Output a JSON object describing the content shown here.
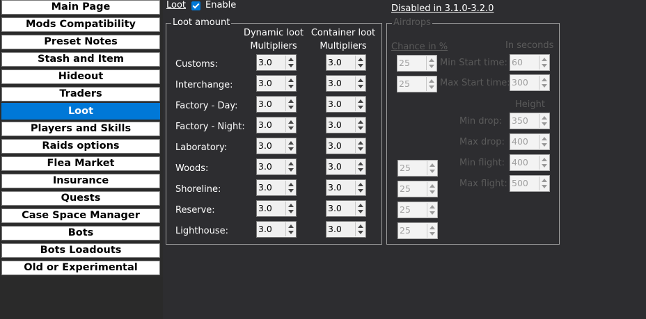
{
  "sidebar": {
    "items": [
      {
        "label": "Main Page",
        "active": false
      },
      {
        "label": "Mods Compatibility",
        "active": false
      },
      {
        "label": "Preset Notes",
        "active": false
      },
      {
        "label": "Stash and Item",
        "active": false
      },
      {
        "label": "Hideout",
        "active": false
      },
      {
        "label": "Traders",
        "active": false
      },
      {
        "label": "Loot",
        "active": true
      },
      {
        "label": "Players and Skills",
        "active": false
      },
      {
        "label": "Raids options",
        "active": false
      },
      {
        "label": "Flea Market",
        "active": false
      },
      {
        "label": "Insurance",
        "active": false
      },
      {
        "label": "Quests",
        "active": false
      },
      {
        "label": "Case Space Manager",
        "active": false
      },
      {
        "label": "Bots",
        "active": false
      },
      {
        "label": "Bots Loadouts",
        "active": false
      },
      {
        "label": "Old or Experimental",
        "active": false
      }
    ]
  },
  "header": {
    "section_link": "Loot",
    "enable_label": "Enable",
    "enable_checked": true,
    "disabled_note": "Disabled in 3.1.0-3.2.0"
  },
  "loot_amount": {
    "title": "Loot amount",
    "col_dynamic": [
      "Dynamic loot",
      "Multipliers"
    ],
    "col_container": [
      "Container loot",
      "Multipliers"
    ],
    "rows": [
      {
        "map": "Customs:",
        "dynamic": "3.0",
        "container": "3.0"
      },
      {
        "map": "Interchange:",
        "dynamic": "3.0",
        "container": "3.0"
      },
      {
        "map": "Factory - Day:",
        "dynamic": "3.0",
        "container": "3.0"
      },
      {
        "map": "Factory - Night:",
        "dynamic": "3.0",
        "container": "3.0"
      },
      {
        "map": "Laboratory:",
        "dynamic": "3.0",
        "container": "3.0"
      },
      {
        "map": "Woods:",
        "dynamic": "3.0",
        "container": "3.0"
      },
      {
        "map": "Shoreline:",
        "dynamic": "3.0",
        "container": "3.0"
      },
      {
        "map": "Reserve:",
        "dynamic": "3.0",
        "container": "3.0"
      },
      {
        "map": "Lighthouse:",
        "dynamic": "3.0",
        "container": "3.0"
      }
    ]
  },
  "airdrops": {
    "title": "Airdrops",
    "chance_header": "Chance in %",
    "seconds_header": "In seconds",
    "height_header": "Height",
    "chance_values": [
      "25",
      "25",
      "25",
      "25",
      "25",
      "25"
    ],
    "min_start_label": "Min Start time:",
    "min_start_value": "60",
    "max_start_label": "Max Start time:",
    "max_start_value": "300",
    "min_drop_label": "Min drop:",
    "min_drop_value": "350",
    "max_drop_label": "Max drop:",
    "max_drop_value": "400",
    "min_flight_label": "Min flight:",
    "min_flight_value": "400",
    "max_flight_label": "Max flight:",
    "max_flight_value": "500"
  }
}
